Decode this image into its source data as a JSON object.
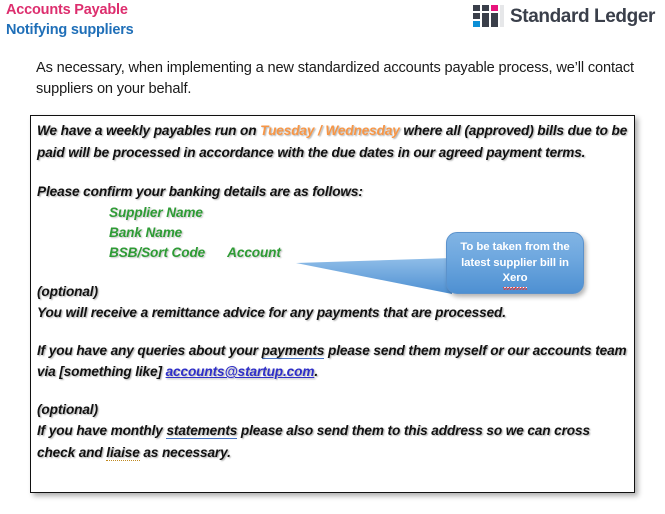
{
  "header": {
    "title_line1": "Accounts Payable",
    "title_line2": "Notifying suppliers",
    "title_color_1": "#DD2E6E",
    "title_color_2": "#1F6FB8"
  },
  "brand": {
    "name": "Standard Ledger",
    "logo_icon": "grid-squares-logo",
    "logo_colors": {
      "dark": "#3A3F4A",
      "magenta": "#E8147C",
      "cyan": "#0C8FD6",
      "light": "#E6E7E9"
    },
    "wordmark_color": "#3A3F4A"
  },
  "intro": {
    "text": "As necessary, when implementing a new standardized accounts payable process, we’ll contact suppliers on your behalf."
  },
  "letter": {
    "para1_before": "We have a weekly payables run on ",
    "para1_highlight": "Tuesday / Wednesday",
    "para1_after": " where all (approved) bills due to be paid will be processed in accordance with the due dates in our agreed payment terms.",
    "highlight_color": "#F79646",
    "para2": "Please confirm your banking details are as follows:",
    "bank_fields": {
      "supplier_name": "Supplier Name",
      "bank_name": "Bank Name",
      "bsb_sort_code": "BSB/Sort Code",
      "account": "Account",
      "color": "#2E9B35"
    },
    "optional_label_1": "(optional)",
    "para3": "You will receive a remittance advice for any payments that are processed.",
    "para4_a": "If you have any queries about your ",
    "para4_spell": "payments",
    "para4_b": " please send them myself or our accounts team via [something like] ",
    "para4_email": "accounts@startup.com",
    "para4_c": ".",
    "email_color": "#2E2EC8",
    "optional_label_2": "(optional)",
    "para5_a": "If you have monthly ",
    "para5_spell": "statements",
    "para5_b": " please also send them to this address so we can cross check and ",
    "para5_spell2": "liaise",
    "para5_c": " as necessary."
  },
  "callout": {
    "line1": "To be taken from the",
    "line2": "latest supplier bill in",
    "line3": "Xero",
    "fill_color": "#6FA8DF",
    "text_color": "#FFFFFF",
    "spellcheck_color": "#E03B3B",
    "pointer_icon": "callout-tail-arrow"
  }
}
